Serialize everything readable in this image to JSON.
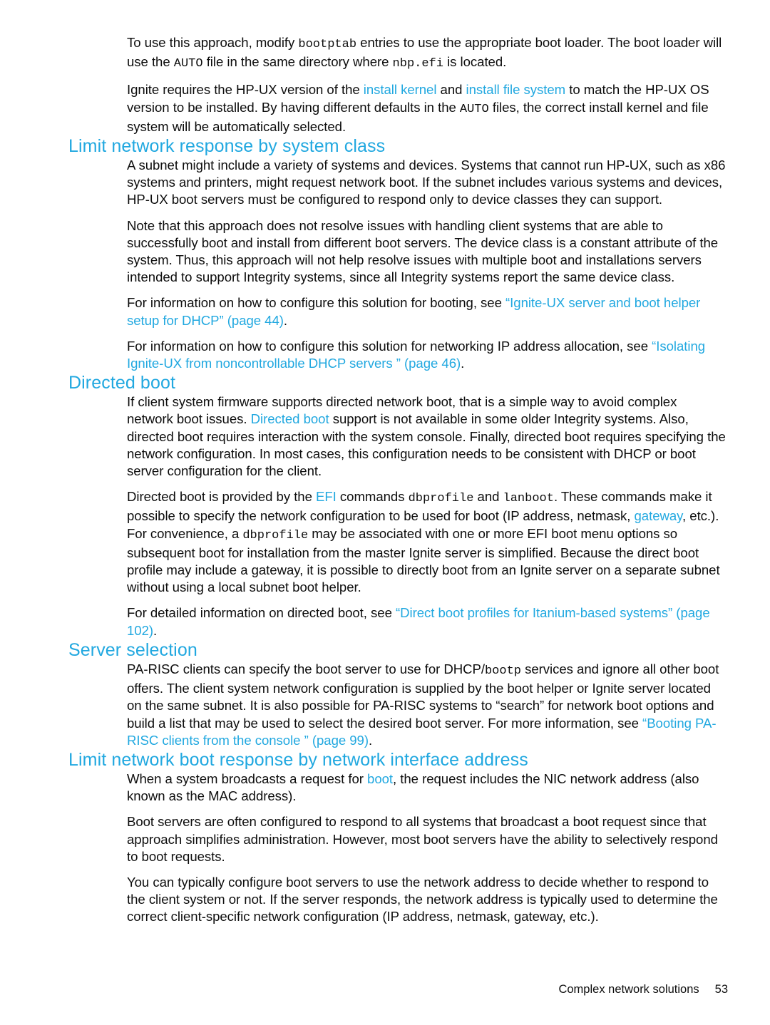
{
  "page": {
    "number": "53",
    "footer_title": "Complex network solutions",
    "accent_color": "#21a8e0",
    "text_color": "#0d0d0d"
  },
  "intro": {
    "para1": {
      "t1": "To use this approach, modify ",
      "code1": "bootptab",
      "t2": " entries to use the appropriate boot loader. The boot loader will use the ",
      "code2": "AUTO",
      "t3": " file in the same directory where ",
      "code3": "nbp.efi",
      "t4": " is located."
    },
    "para2": {
      "t1": "Ignite requires the HP-UX version of the ",
      "link1": "install kernel",
      "t2": " and ",
      "link2": "install file system",
      "t3": " to match the HP-UX OS version to be installed. By having different defaults in the ",
      "code1": "AUTO",
      "t4": " files, the correct install kernel and file system will be automatically selected."
    }
  },
  "sections": {
    "limit_by_class": {
      "heading": "Limit network response by system class",
      "para1": "A subnet might include a variety of systems and devices. Systems that cannot run HP-UX, such as x86 systems and printers, might request network boot. If the subnet includes various systems and devices, HP-UX boot servers must be configured to respond only to device classes they can support.",
      "para2": "Note that this approach does not resolve issues with handling client systems that are able to successfully boot and install from different boot servers. The device class is a constant attribute of the system. Thus, this approach will not help resolve issues with multiple boot and installations servers intended to support Integrity systems, since all Integrity systems report the same device class.",
      "para3": {
        "t1": "For information on how to configure this solution for booting, see ",
        "xref": "“Ignite-UX server and boot helper setup for DHCP” (page 44)",
        "t2": "."
      },
      "para4": {
        "t1": "For information on how to configure this solution for networking IP address allocation, see ",
        "xref": "“Isolating Ignite-UX from noncontrollable DHCP servers ” (page 46)",
        "t2": "."
      }
    },
    "directed_boot": {
      "heading": "Directed boot",
      "para1": {
        "t1": "If client system firmware supports directed network boot, that is a simple way to avoid complex network boot issues. ",
        "link1": "Directed boot",
        "t2": " support is not available in some older Integrity systems. Also, directed boot requires interaction with the system console. Finally, directed boot requires specifying the network configuration. In most cases, this configuration needs to be consistent with DHCP or boot server configuration for the client."
      },
      "para2": {
        "t1": "Directed boot is provided by the ",
        "link1": "EFI",
        "t2": " commands ",
        "code1": "dbprofile",
        "t3": " and ",
        "code2": "lanboot",
        "t4": ". These commands make it possible to specify the network configuration to be used for boot (IP address, netmask, ",
        "link2": "gateway",
        "t5": ", etc.). For convenience, a ",
        "code3": "dbprofile",
        "t6": " may be associated with one or more EFI boot menu options so subsequent boot for installation from the master Ignite server is simplified. Because the direct boot profile may include a gateway, it is possible to directly boot from an Ignite server on a separate subnet without using a local subnet boot helper."
      },
      "para3": {
        "t1": "For detailed information on directed boot, see ",
        "xref": "“Direct boot profiles for Itanium-based systems” (page 102)",
        "t2": "."
      }
    },
    "server_selection": {
      "heading": "Server selection",
      "para1": {
        "t1": "PA-RISC clients can specify the boot server to use for DHCP/",
        "code1": "bootp",
        "t2": " services and ignore all other boot offers. The client system network configuration is supplied by the boot helper or Ignite server located on the same subnet. It is also possible for PA-RISC systems to “search” for network boot options and build a list that may be used to select the desired boot server. For more information, see ",
        "xref": "“Booting PA-RISC clients from the console ” (page 99)",
        "t3": "."
      }
    },
    "limit_by_nic": {
      "heading": "Limit network boot response by network interface address",
      "para1": {
        "t1": "When a system broadcasts a request for ",
        "link1": "boot",
        "t2": ", the request includes the NIC network address (also known as the MAC address)."
      },
      "para2": "Boot servers are often configured to respond to all systems that broadcast a boot request since that approach simplifies administration. However, most boot servers have the ability to selectively respond to boot requests.",
      "para3": "You can typically configure boot servers to use the network address to decide whether to respond to the client system or not. If the server responds, the network address is typically used to determine the correct client-specific network configuration (IP address, netmask, gateway, etc.)."
    }
  }
}
